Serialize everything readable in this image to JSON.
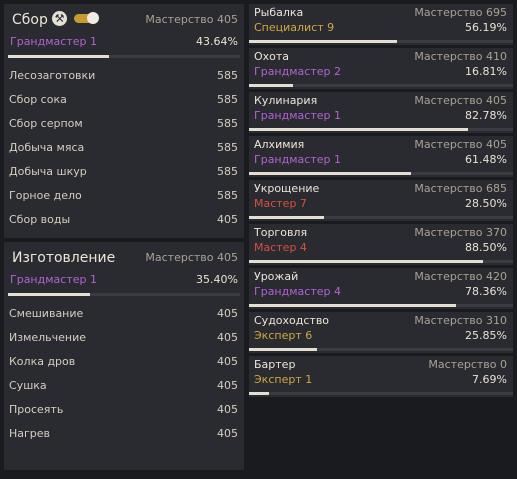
{
  "colors": {
    "grandmaster": "#b461d6",
    "master": "#d94f3e",
    "specialist": "#d1a93f",
    "expert": "#d1a93f"
  },
  "gathering": {
    "title": "Сбор",
    "mastery": "Мастерство 405",
    "rank": "Грандмастер 1",
    "rank_color": "#b461d6",
    "percent": "43.64%",
    "progress": 0.4364,
    "toggle_on": true,
    "items": [
      {
        "name": "Лесозаготовки",
        "value": "585"
      },
      {
        "name": "Сбор сока",
        "value": "585"
      },
      {
        "name": "Сбор серпом",
        "value": "585"
      },
      {
        "name": "Добыча мяса",
        "value": "585"
      },
      {
        "name": "Добыча шкур",
        "value": "585"
      },
      {
        "name": "Горное дело",
        "value": "585"
      },
      {
        "name": "Сбор воды",
        "value": "405"
      }
    ]
  },
  "crafting": {
    "title": "Изготовление",
    "mastery": "Мастерство 405",
    "rank": "Грандмастер 1",
    "rank_color": "#b461d6",
    "percent": "35.40%",
    "progress": 0.354,
    "items": [
      {
        "name": "Смешивание",
        "value": "405"
      },
      {
        "name": "Измельчение",
        "value": "405"
      },
      {
        "name": "Колка дров",
        "value": "405"
      },
      {
        "name": "Сушка",
        "value": "405"
      },
      {
        "name": "Просеять",
        "value": "405"
      },
      {
        "name": "Нагрев",
        "value": "405"
      }
    ]
  },
  "skills": [
    {
      "name": "Рыбалка",
      "mastery": "Мастерство 695",
      "rank": "Специалист 9",
      "rank_color": "#d1a93f",
      "percent": "56.19%",
      "progress": 0.5619
    },
    {
      "name": "Охота",
      "mastery": "Мастерство 410",
      "rank": "Грандмастер 2",
      "rank_color": "#b461d6",
      "percent": "16.81%",
      "progress": 0.1681
    },
    {
      "name": "Кулинария",
      "mastery": "Мастерство 405",
      "rank": "Грандмастер 1",
      "rank_color": "#b461d6",
      "percent": "82.78%",
      "progress": 0.8278
    },
    {
      "name": "Алхимия",
      "mastery": "Мастерство 405",
      "rank": "Грандмастер 1",
      "rank_color": "#b461d6",
      "percent": "61.48%",
      "progress": 0.6148
    },
    {
      "name": "Укрощение",
      "mastery": "Мастерство 685",
      "rank": "Мастер 7",
      "rank_color": "#d94f3e",
      "percent": "28.50%",
      "progress": 0.285
    },
    {
      "name": "Торговля",
      "mastery": "Мастерство 370",
      "rank": "Мастер 4",
      "rank_color": "#d94f3e",
      "percent": "88.50%",
      "progress": 0.885
    },
    {
      "name": "Урожай",
      "mastery": "Мастерство 420",
      "rank": "Грандмастер 4",
      "rank_color": "#b461d6",
      "percent": "78.36%",
      "progress": 0.7836
    },
    {
      "name": "Судоходство",
      "mastery": "Мастерство 310",
      "rank": "Эксперт 6",
      "rank_color": "#d1a93f",
      "percent": "25.85%",
      "progress": 0.2585
    },
    {
      "name": "Бартер",
      "mastery": "Мастерство 0",
      "rank": "Эксперт 1",
      "rank_color": "#d1a93f",
      "percent": "7.69%",
      "progress": 0.0769
    }
  ]
}
